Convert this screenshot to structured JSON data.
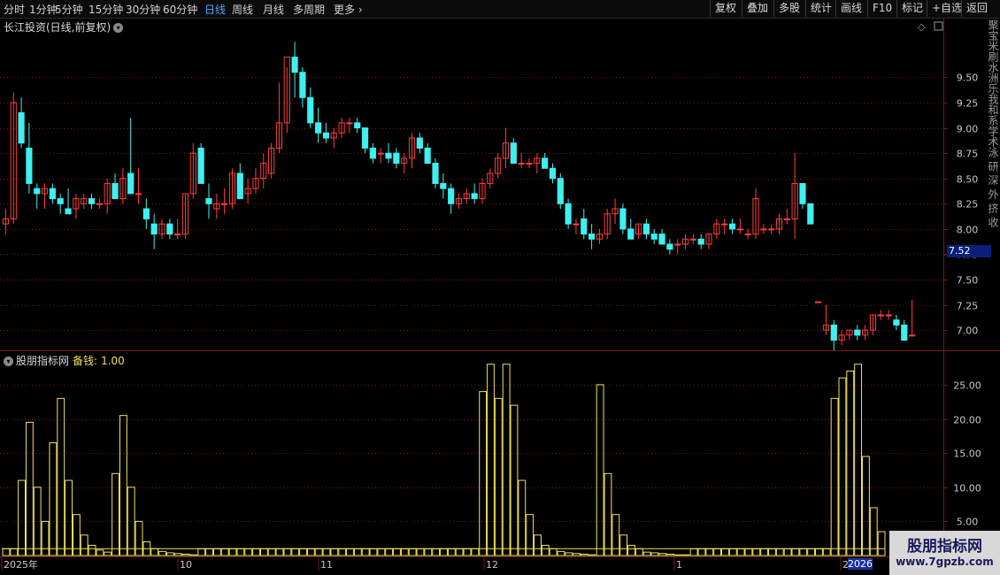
{
  "toolbar": {
    "timeframes": [
      "分时",
      "1分钟",
      "5分钟",
      "15分钟",
      "30分钟",
      "60分钟",
      "日线",
      "周线",
      "月线",
      "多周期",
      "更多"
    ],
    "active_timeframe": "日线",
    "right_buttons": [
      "复权",
      "叠加",
      "多股",
      "统计",
      "画线",
      "F10",
      "标记",
      "+自选",
      "返回"
    ]
  },
  "main_chart": {
    "title": "长江投资(日线,前复权)",
    "price_tag": "7.52",
    "y_ticks": [
      "9.50",
      "9.25",
      "9.00",
      "8.75",
      "8.50",
      "8.25",
      "8.00",
      "7.75",
      "7.50",
      "7.25",
      "7.00"
    ],
    "side_glyphs": "聚宝米刷水洲乐我和系学术泳 研 深 外 挤 收"
  },
  "sub_chart": {
    "title": "股朋指标网",
    "label": "备钱:",
    "value": "1.00",
    "y_ticks": [
      "25.00",
      "20.00",
      "15.00",
      "10.00",
      "5.00"
    ]
  },
  "x_axis": {
    "labels": [
      "2025年",
      "10",
      "11",
      "12",
      "1",
      "2",
      "2026"
    ]
  },
  "watermark": {
    "line1": "股朋指标网",
    "line2": "www.7gpzb.com"
  },
  "colors": {
    "up": "#ff3d3d",
    "down": "#3ef0f0",
    "indicator": "#f0e060",
    "grid": "#7a1818",
    "active_tab": "#4aa8ff"
  },
  "chart_data": [
    {
      "type": "candlestick",
      "title": "长江投资(日线,前复权)",
      "ylim": [
        6.8,
        9.95
      ],
      "y_ticks": [
        9.5,
        9.25,
        9.0,
        8.75,
        8.5,
        8.25,
        8.0,
        7.75,
        7.5,
        7.25,
        7.0
      ],
      "ohlc": [
        [
          8.05,
          8.2,
          7.95,
          8.1
        ],
        [
          8.1,
          9.35,
          8.05,
          9.25
        ],
        [
          9.15,
          9.3,
          8.8,
          8.85
        ],
        [
          8.8,
          9.05,
          8.35,
          8.45
        ],
        [
          8.4,
          8.45,
          8.2,
          8.35
        ],
        [
          8.35,
          8.45,
          8.2,
          8.4
        ],
        [
          8.4,
          8.45,
          8.25,
          8.3
        ],
        [
          8.3,
          8.35,
          8.15,
          8.25
        ],
        [
          8.2,
          8.4,
          8.15,
          8.15
        ],
        [
          8.2,
          8.35,
          8.1,
          8.3
        ],
        [
          8.25,
          8.35,
          8.2,
          8.3
        ],
        [
          8.3,
          8.35,
          8.2,
          8.25
        ],
        [
          8.25,
          8.3,
          8.2,
          8.25
        ],
        [
          8.25,
          8.5,
          8.15,
          8.45
        ],
        [
          8.45,
          8.55,
          8.3,
          8.3
        ],
        [
          8.3,
          8.6,
          8.25,
          8.5
        ],
        [
          8.55,
          9.1,
          8.35,
          8.35
        ],
        [
          8.35,
          8.6,
          8.25,
          8.35
        ],
        [
          8.2,
          8.3,
          8.0,
          8.1
        ],
        [
          8.05,
          8.15,
          7.8,
          7.95
        ],
        [
          7.95,
          8.1,
          7.9,
          8.05
        ],
        [
          8.05,
          8.1,
          7.9,
          7.95
        ],
        [
          7.95,
          8.1,
          7.9,
          7.95
        ],
        [
          7.95,
          8.35,
          7.9,
          8.35
        ],
        [
          8.35,
          8.85,
          8.3,
          8.75
        ],
        [
          8.8,
          8.85,
          8.45,
          8.45
        ],
        [
          8.3,
          8.45,
          8.1,
          8.25
        ],
        [
          8.2,
          8.35,
          8.1,
          8.25
        ],
        [
          8.25,
          8.4,
          8.15,
          8.25
        ],
        [
          8.25,
          8.6,
          8.2,
          8.55
        ],
        [
          8.55,
          8.65,
          8.3,
          8.3
        ],
        [
          8.35,
          8.5,
          8.25,
          8.4
        ],
        [
          8.4,
          8.6,
          8.35,
          8.5
        ],
        [
          8.5,
          8.75,
          8.4,
          8.65
        ],
        [
          8.55,
          8.85,
          8.5,
          8.8
        ],
        [
          8.8,
          9.45,
          8.75,
          9.05
        ],
        [
          9.05,
          9.6,
          8.95,
          9.7
        ],
        [
          9.7,
          9.85,
          9.3,
          9.55
        ],
        [
          9.55,
          9.6,
          9.2,
          9.3
        ],
        [
          9.3,
          9.4,
          9.0,
          9.05
        ],
        [
          9.05,
          9.2,
          8.85,
          8.95
        ],
        [
          8.95,
          9.05,
          8.85,
          8.9
        ],
        [
          8.9,
          9.0,
          8.8,
          8.95
        ],
        [
          8.95,
          9.1,
          8.9,
          9.05
        ],
        [
          9.05,
          9.1,
          8.95,
          9.05
        ],
        [
          9.05,
          9.1,
          8.95,
          9.0
        ],
        [
          9.0,
          9.0,
          8.75,
          8.8
        ],
        [
          8.8,
          8.85,
          8.65,
          8.7
        ],
        [
          8.75,
          8.8,
          8.65,
          8.75
        ],
        [
          8.75,
          8.85,
          8.65,
          8.7
        ],
        [
          8.75,
          8.8,
          8.6,
          8.65
        ],
        [
          8.65,
          8.75,
          8.55,
          8.7
        ],
        [
          8.7,
          8.95,
          8.6,
          8.9
        ],
        [
          8.9,
          8.95,
          8.75,
          8.8
        ],
        [
          8.8,
          8.85,
          8.65,
          8.65
        ],
        [
          8.65,
          8.7,
          8.4,
          8.45
        ],
        [
          8.45,
          8.55,
          8.3,
          8.4
        ],
        [
          8.4,
          8.45,
          8.15,
          8.25
        ],
        [
          8.25,
          8.35,
          8.2,
          8.3
        ],
        [
          8.3,
          8.4,
          8.25,
          8.35
        ],
        [
          8.35,
          8.45,
          8.25,
          8.3
        ],
        [
          8.3,
          8.5,
          8.25,
          8.45
        ],
        [
          8.45,
          8.6,
          8.4,
          8.55
        ],
        [
          8.55,
          8.75,
          8.5,
          8.7
        ],
        [
          8.7,
          9.0,
          8.6,
          8.85
        ],
        [
          8.85,
          8.9,
          8.65,
          8.65
        ],
        [
          8.65,
          8.75,
          8.6,
          8.65
        ],
        [
          8.65,
          8.7,
          8.6,
          8.65
        ],
        [
          8.65,
          8.75,
          8.55,
          8.7
        ],
        [
          8.7,
          8.75,
          8.6,
          8.6
        ],
        [
          8.6,
          8.65,
          8.45,
          8.5
        ],
        [
          8.5,
          8.55,
          8.2,
          8.25
        ],
        [
          8.25,
          8.3,
          8.0,
          8.05
        ],
        [
          8.05,
          8.1,
          7.95,
          8.05
        ],
        [
          8.1,
          8.2,
          7.9,
          7.95
        ],
        [
          7.95,
          8.05,
          7.8,
          7.9
        ],
        [
          7.9,
          8.0,
          7.85,
          7.95
        ],
        [
          7.95,
          8.2,
          7.9,
          8.15
        ],
        [
          8.15,
          8.3,
          8.05,
          8.2
        ],
        [
          8.2,
          8.25,
          7.95,
          8.0
        ],
        [
          8.0,
          8.1,
          7.9,
          7.9
        ],
        [
          7.95,
          8.05,
          7.9,
          8.05
        ],
        [
          8.05,
          8.1,
          7.9,
          7.95
        ],
        [
          7.95,
          8.0,
          7.85,
          7.9
        ],
        [
          7.95,
          8.0,
          7.85,
          7.85
        ],
        [
          7.85,
          7.9,
          7.75,
          7.8
        ],
        [
          7.85,
          7.9,
          7.75,
          7.85
        ],
        [
          7.85,
          7.95,
          7.8,
          7.9
        ],
        [
          7.9,
          7.95,
          7.85,
          7.9
        ],
        [
          7.9,
          7.95,
          7.8,
          7.85
        ],
        [
          7.85,
          7.95,
          7.8,
          7.95
        ],
        [
          7.95,
          8.1,
          7.9,
          8.05
        ],
        [
          8.05,
          8.1,
          7.95,
          8.05
        ],
        [
          8.05,
          8.1,
          7.95,
          8.0
        ],
        [
          8.0,
          8.1,
          7.95,
          8.0
        ],
        [
          7.95,
          8.0,
          7.9,
          7.95
        ],
        [
          7.95,
          8.4,
          7.9,
          8.3
        ],
        [
          8.0,
          8.05,
          7.95,
          8.0
        ],
        [
          8.0,
          8.05,
          7.95,
          8.0
        ],
        [
          8.0,
          8.15,
          7.95,
          8.1
        ],
        [
          8.1,
          8.2,
          8.05,
          8.1
        ],
        [
          8.1,
          8.75,
          7.9,
          8.45
        ],
        [
          8.45,
          8.4,
          8.2,
          8.25
        ],
        [
          8.25,
          8.25,
          8.05,
          8.05
        ],
        [
          7.28,
          7.28,
          7.28,
          7.28
        ],
        [
          7.0,
          7.25,
          6.95,
          7.05
        ],
        [
          7.05,
          7.1,
          6.8,
          6.9
        ],
        [
          6.9,
          7.0,
          6.85,
          6.95
        ],
        [
          6.95,
          7.0,
          6.9,
          7.0
        ],
        [
          7.0,
          7.05,
          6.9,
          6.95
        ],
        [
          6.95,
          7.05,
          6.9,
          7.0
        ],
        [
          7.0,
          7.15,
          6.95,
          7.15
        ],
        [
          7.15,
          7.2,
          7.1,
          7.15
        ],
        [
          7.15,
          7.2,
          7.1,
          7.15
        ],
        [
          7.1,
          7.15,
          7.0,
          7.05
        ],
        [
          7.05,
          7.1,
          6.9,
          6.9
        ],
        [
          6.95,
          7.3,
          6.95,
          6.95
        ]
      ]
    },
    {
      "type": "bar",
      "title": "股朋指标网",
      "ylim": [
        0,
        29
      ],
      "y_ticks": [
        25,
        20,
        15,
        10,
        5
      ],
      "values": [
        1,
        1,
        11,
        19.5,
        10,
        5,
        16.5,
        23,
        11,
        6,
        3,
        1.5,
        0.8,
        0.5,
        12,
        20.5,
        10,
        5,
        2,
        1,
        0.6,
        0.4,
        0.3,
        0.2,
        0.1,
        1,
        1,
        1,
        1,
        1,
        1,
        1,
        1,
        1,
        1,
        1,
        1,
        1,
        1,
        1,
        1,
        1,
        1,
        1,
        1,
        1,
        1,
        1,
        1,
        1,
        1,
        1,
        1,
        1,
        1,
        1,
        1,
        1,
        1,
        1,
        1,
        24,
        28,
        23,
        28,
        22,
        11,
        6,
        3,
        1.5,
        1,
        0.6,
        0.4,
        0.3,
        0.2,
        0.1,
        25,
        12,
        6,
        3,
        1.5,
        1,
        0.5,
        0.4,
        0.3,
        0.2,
        0.1,
        0.1,
        1,
        1,
        1,
        1,
        1,
        1,
        1,
        1,
        1,
        1,
        1,
        1,
        1,
        1,
        1,
        1,
        1,
        1,
        23,
        26,
        27,
        28,
        14.5,
        7,
        3.5
      ]
    }
  ]
}
